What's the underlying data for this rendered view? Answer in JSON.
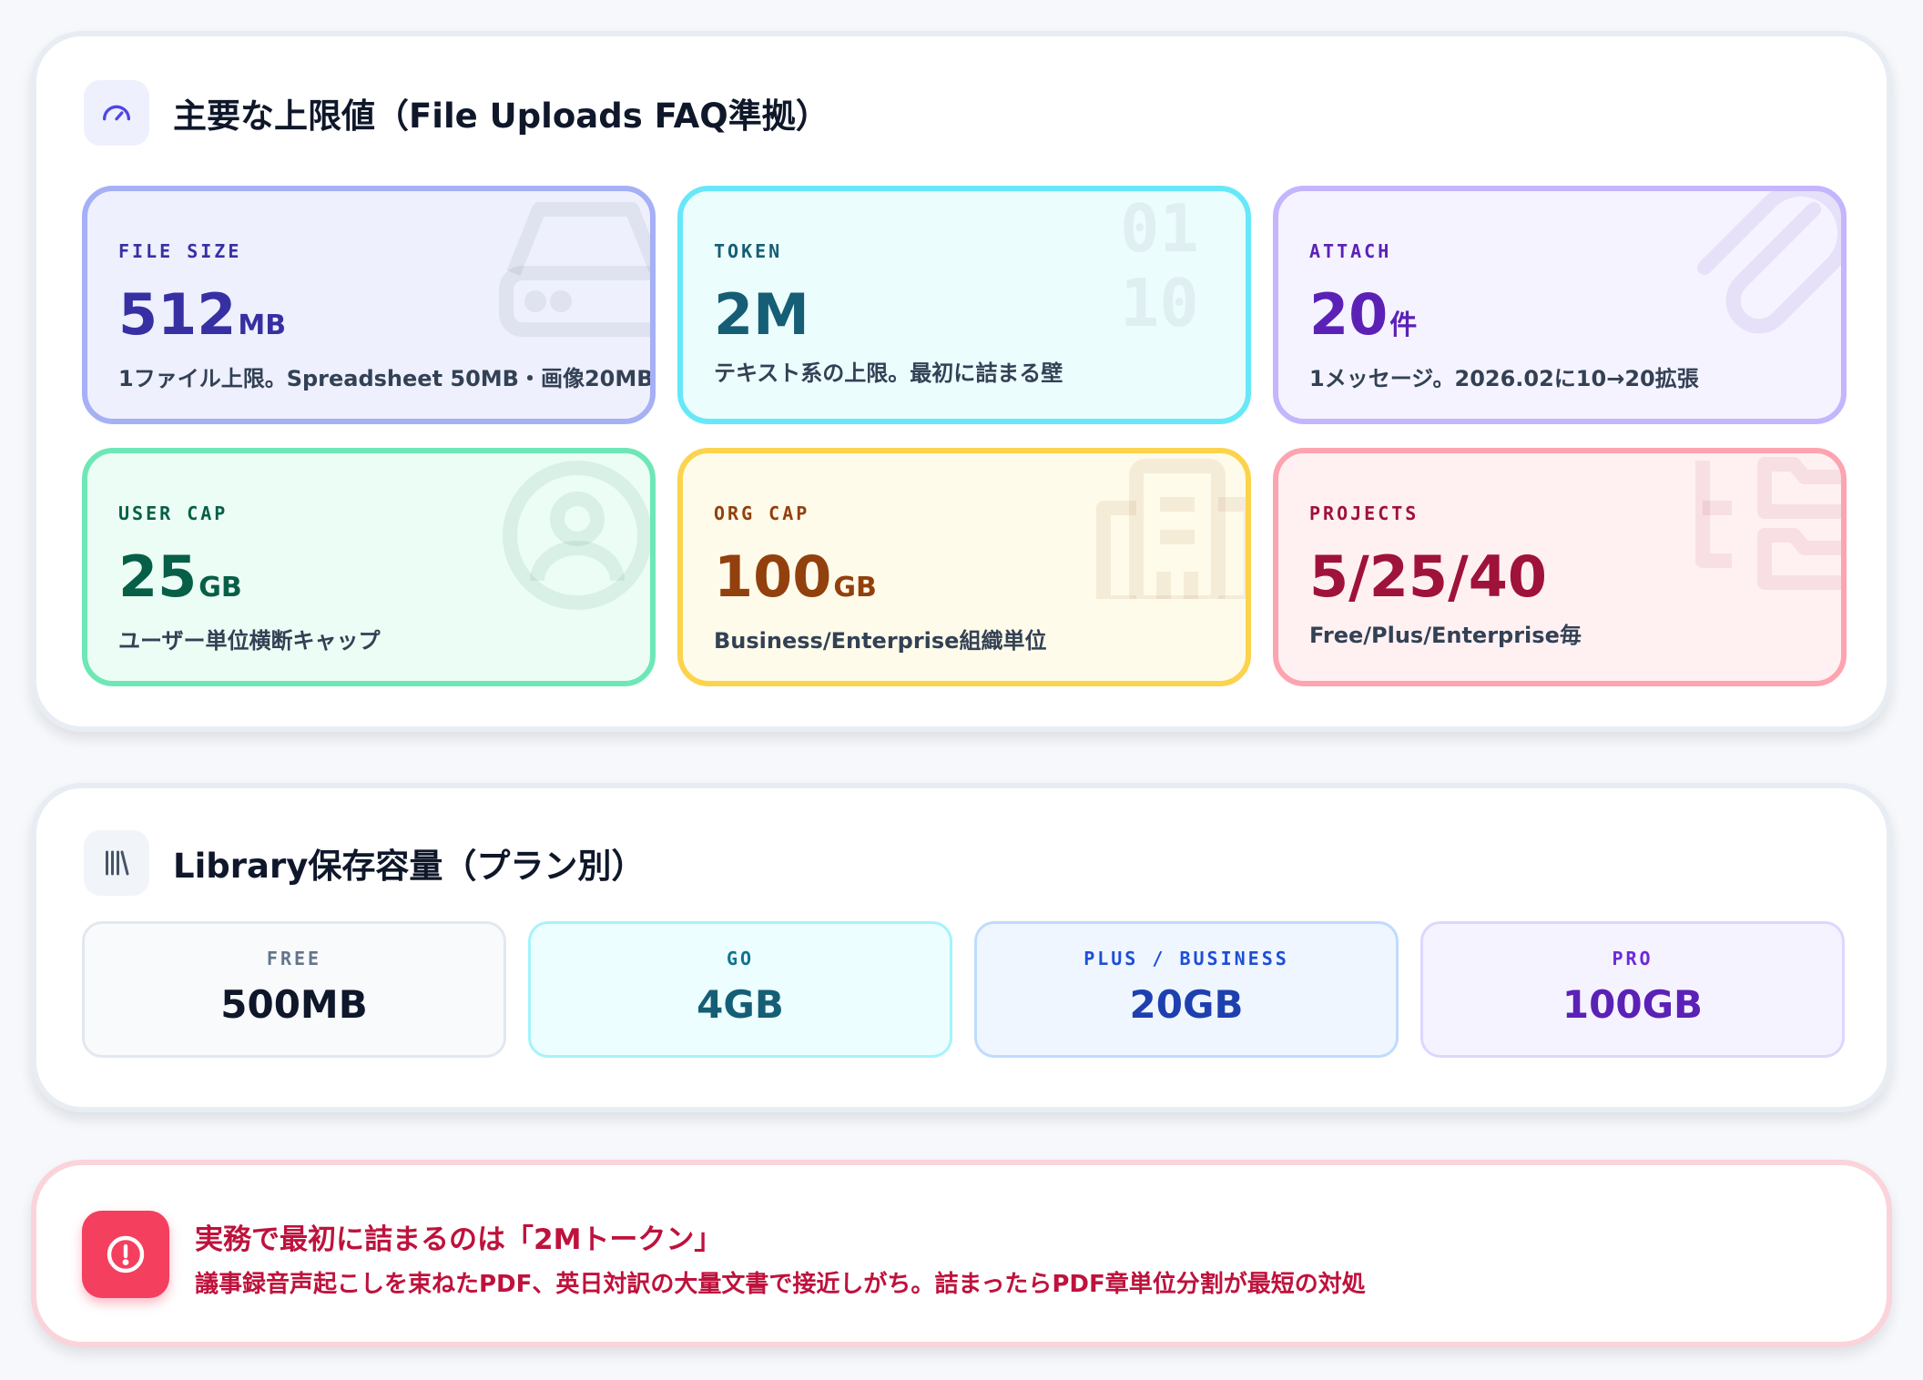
{
  "limits": {
    "title": "主要な上限値（File Uploads FAQ準拠）",
    "icon": "speedometer-icon",
    "cards": [
      {
        "label": "FILE SIZE",
        "value": "512",
        "unit": "MB",
        "desc": "1ファイル上限。Spreadsheet 50MB・画像20MB",
        "icon": "hard-drive-icon",
        "accent": "#3730a3",
        "bg": "#eef0fd",
        "border": "#a5b0f5"
      },
      {
        "label": "TOKEN",
        "value": "2M",
        "unit": "",
        "desc": "テキスト系の上限。最初に詰まる壁",
        "icon": "binary-icon",
        "accent": "#155e75",
        "bg": "#ecfdfe",
        "border": "#67e8f9"
      },
      {
        "label": "ATTACH",
        "value": "20",
        "unit": "件",
        "desc": "1メッセージ。2026.02に10→20拡張",
        "icon": "paperclip-icon",
        "accent": "#5b21b6",
        "bg": "#f5f3ff",
        "border": "#c4b5fd"
      },
      {
        "label": "USER CAP",
        "value": "25",
        "unit": "GB",
        "desc": "ユーザー単位横断キャップ",
        "icon": "user-circle-icon",
        "accent": "#065f46",
        "bg": "#ecfdf5",
        "border": "#6ee7b7"
      },
      {
        "label": "ORG CAP",
        "value": "100",
        "unit": "GB",
        "desc": "Business/Enterprise組織単位",
        "icon": "building-icon",
        "accent": "#92400e",
        "bg": "#fefbea",
        "border": "#fcd34d"
      },
      {
        "label": "PROJECTS",
        "value": "5/25/40",
        "unit": "",
        "desc": "Free/Plus/Enterprise毎",
        "icon": "folders-icon",
        "accent": "#9f1239",
        "bg": "#fff1f2",
        "border": "#fda4af"
      }
    ]
  },
  "library": {
    "title": "Library保存容量（プラン別）",
    "icon": "library-icon",
    "tiers": [
      {
        "label": "FREE",
        "value": "500MB",
        "label_color": "#64748b",
        "value_color": "#0f172a",
        "bg": "#f8fafc",
        "border": "#e2e8f0"
      },
      {
        "label": "GO",
        "value": "4GB",
        "label_color": "#0e7490",
        "value_color": "#155e75",
        "bg": "#ecfeff",
        "border": "#a5f3fc"
      },
      {
        "label": "PLUS / BUSINESS",
        "value": "20GB",
        "label_color": "#1d4ed8",
        "value_color": "#1e40af",
        "bg": "#eff6ff",
        "border": "#bfdbfe"
      },
      {
        "label": "PRO",
        "value": "100GB",
        "label_color": "#6d28d9",
        "value_color": "#5b21b6",
        "bg": "#f5f3ff",
        "border": "#ddd6fe"
      }
    ]
  },
  "alert": {
    "icon": "alert-circle-icon",
    "title": "実務で最初に詰まるのは「2Mトークン」",
    "body": "議事録音声起こしを束ねたPDF、英日対訳の大量文書で接近しがち。詰まったらPDF章単位分割が最短の対処"
  }
}
